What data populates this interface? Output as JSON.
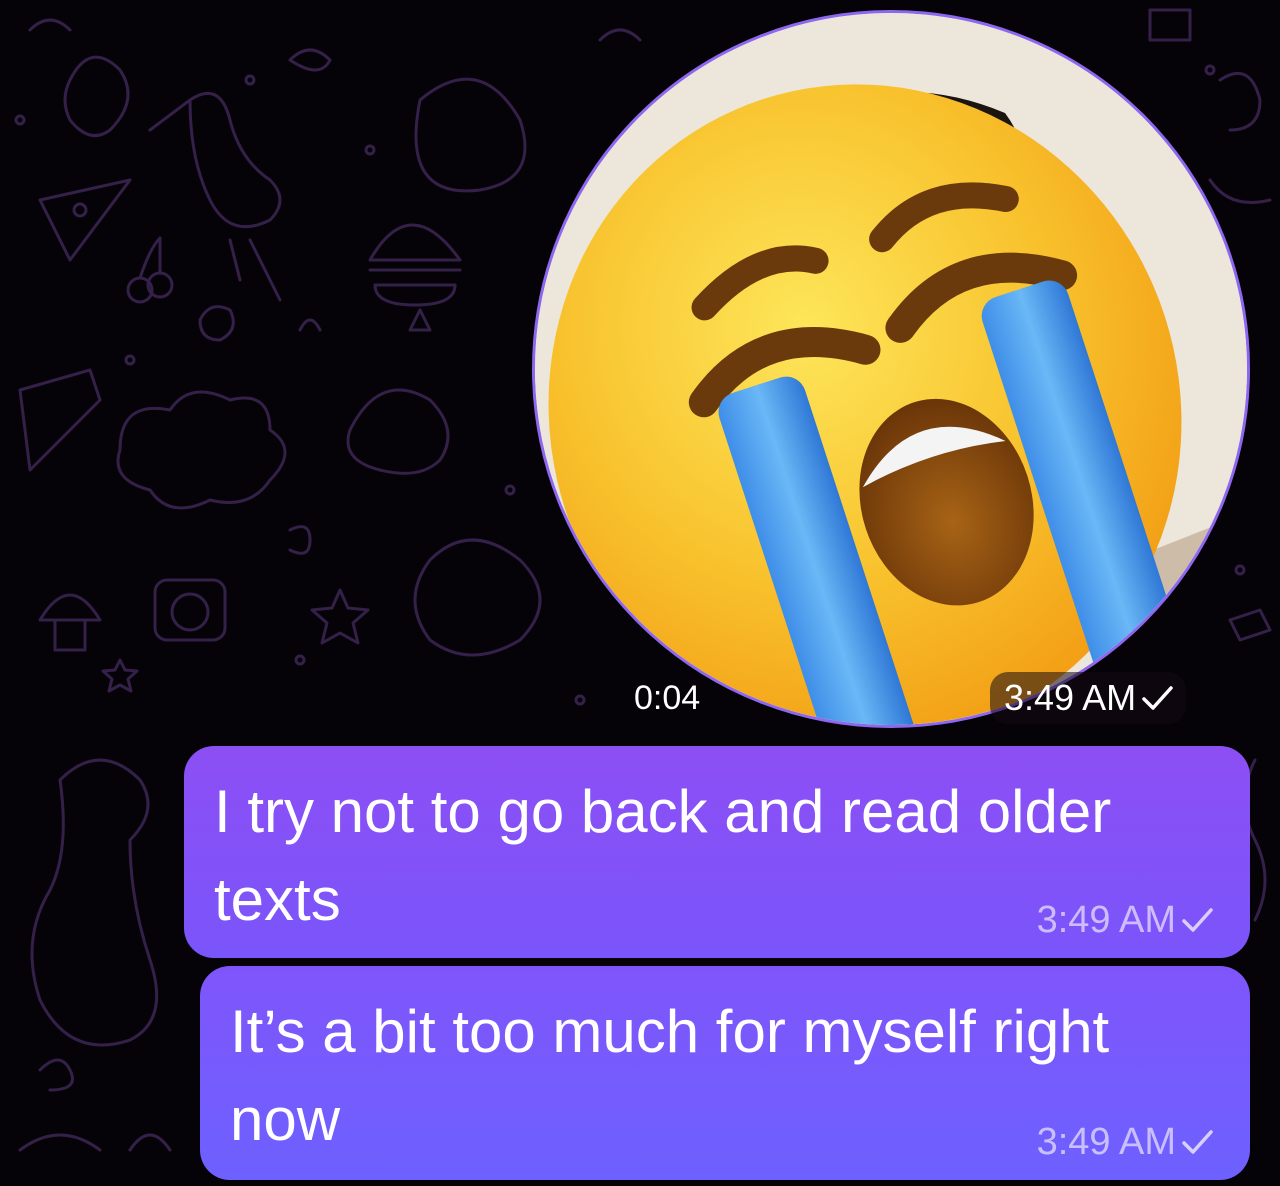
{
  "chat": {
    "accent_color": "#8753f6",
    "background_color": "#050308"
  },
  "video_note": {
    "duration": "0:04",
    "time": "3:49 AM",
    "status_icon": "single-check-icon",
    "overlay_emoji": "loudly-crying-face"
  },
  "messages": [
    {
      "text": "I try not to go back and read older texts",
      "time": "3:49 AM",
      "status_icon": "single-check-icon"
    },
    {
      "text": "It’s a bit too much for myself right now",
      "time": "3:49 AM",
      "status_icon": "single-check-icon"
    }
  ]
}
